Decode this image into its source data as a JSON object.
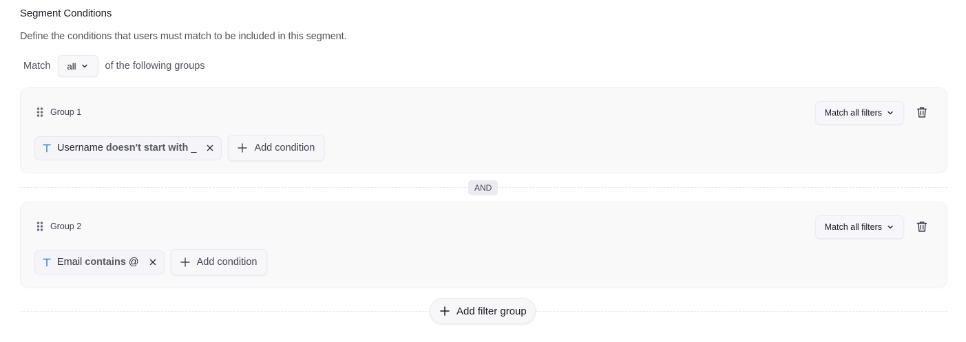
{
  "header": {
    "title": "Segment Conditions",
    "description": "Define the conditions that users must match to be included in this segment."
  },
  "match": {
    "prefix": "Match",
    "selected": "all",
    "suffix": "of the following groups"
  },
  "connector": "AND",
  "groups": [
    {
      "name": "Group 1",
      "filter_mode": "Match all filters",
      "conditions": [
        {
          "field": "Username",
          "operator": "doesn't start with",
          "value": "_"
        }
      ],
      "add_label": "Add condition"
    },
    {
      "name": "Group 2",
      "filter_mode": "Match all filters",
      "conditions": [
        {
          "field": "Email",
          "operator": "contains",
          "value": "@"
        }
      ],
      "add_label": "Add condition"
    }
  ],
  "add_group_label": "Add filter group",
  "icons": {
    "drag": "drag-handle-icon",
    "type": "text-type-icon",
    "remove": "close-icon",
    "add": "plus-icon",
    "delete": "trash-icon",
    "dropdown": "chevron-down-icon"
  },
  "colors": {
    "type_icon": "#3b82c4",
    "group_bg": "#f9f9fa",
    "badge_bg": "#ebebf0"
  }
}
